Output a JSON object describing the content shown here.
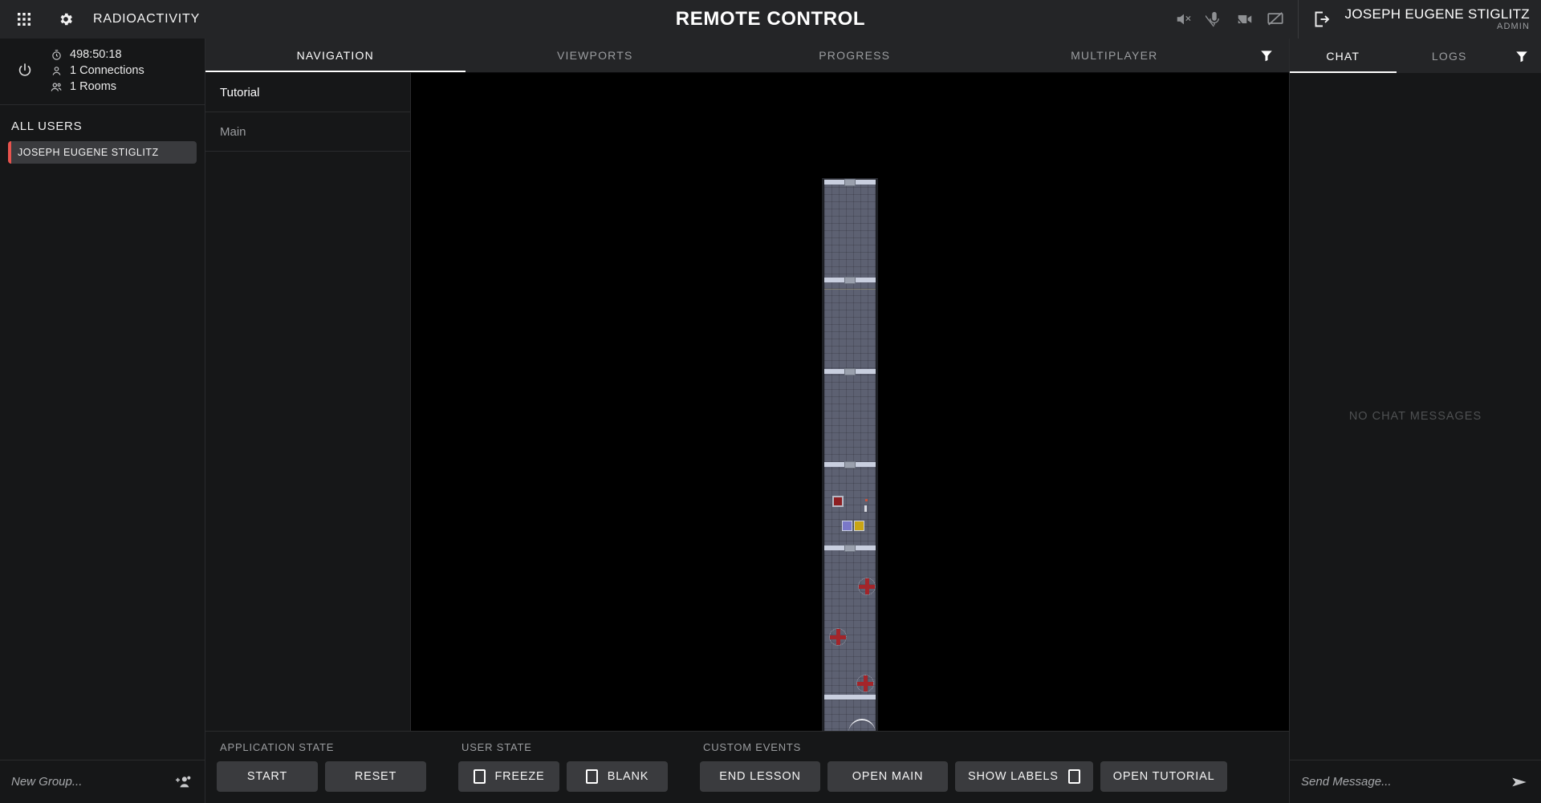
{
  "header": {
    "app_name": "RADIOACTIVITY",
    "title": "REMOTE CONTROL",
    "apps_icon": "apps-grid-icon",
    "settings_icon": "gear-icon",
    "media_icons": [
      "speaker-muted-icon",
      "microphone-muted-icon",
      "camera-muted-icon",
      "screenshare-muted-icon"
    ],
    "logout_icon": "logout-icon",
    "user_name": "JOSEPH EUGENE STIGLITZ",
    "user_role": "ADMIN"
  },
  "sidebar": {
    "power_icon": "power-icon",
    "stats": [
      {
        "icon": "timer-icon",
        "value": "498:50:18"
      },
      {
        "icon": "user-icon",
        "value": "1 Connections"
      },
      {
        "icon": "users-icon",
        "value": "1 Rooms"
      }
    ],
    "section_title": "ALL USERS",
    "users": [
      {
        "name": "JOSEPH EUGENE STIGLITZ",
        "accent": "#e8534d"
      }
    ],
    "new_group_placeholder": "New Group...",
    "new_group_value": "",
    "add_group_icon": "add-users-icon"
  },
  "center": {
    "tabs": [
      {
        "label": "NAVIGATION",
        "active": true
      },
      {
        "label": "VIEWPORTS",
        "active": false
      },
      {
        "label": "PROGRESS",
        "active": false
      },
      {
        "label": "MULTIPLAYER",
        "active": false
      }
    ],
    "filter_icon": "filter-icon",
    "nav_items": [
      {
        "label": "Tutorial",
        "active": true
      },
      {
        "label": "Main",
        "active": false
      }
    ]
  },
  "controls": {
    "groups": [
      {
        "label": "APPLICATION STATE",
        "buttons": [
          {
            "label": "START",
            "checkbox": false
          },
          {
            "label": "RESET",
            "checkbox": false
          }
        ]
      },
      {
        "label": "USER STATE",
        "buttons": [
          {
            "label": "FREEZE",
            "checkbox": true,
            "checkbox_side": "left",
            "checked": false
          },
          {
            "label": "BLANK",
            "checkbox": true,
            "checkbox_side": "left",
            "checked": false
          }
        ]
      },
      {
        "label": "CUSTOM EVENTS",
        "buttons": [
          {
            "label": "END LESSON",
            "checkbox": false
          },
          {
            "label": "OPEN MAIN",
            "checkbox": false
          },
          {
            "label": "SHOW LABELS",
            "checkbox": true,
            "checkbox_side": "right",
            "checked": false
          },
          {
            "label": "OPEN TUTORIAL",
            "checkbox": false
          }
        ]
      }
    ]
  },
  "right_panel": {
    "tabs": [
      {
        "label": "CHAT",
        "active": true
      },
      {
        "label": "LOGS",
        "active": false
      }
    ],
    "filter_icon": "filter-icon",
    "empty_text": "NO CHAT MESSAGES",
    "message_placeholder": "Send Message...",
    "message_value": "",
    "send_icon": "send-icon"
  },
  "viewport": {
    "background": "#000000",
    "floor_color": "#5d6172",
    "wall_color": "#c9cfdf"
  }
}
